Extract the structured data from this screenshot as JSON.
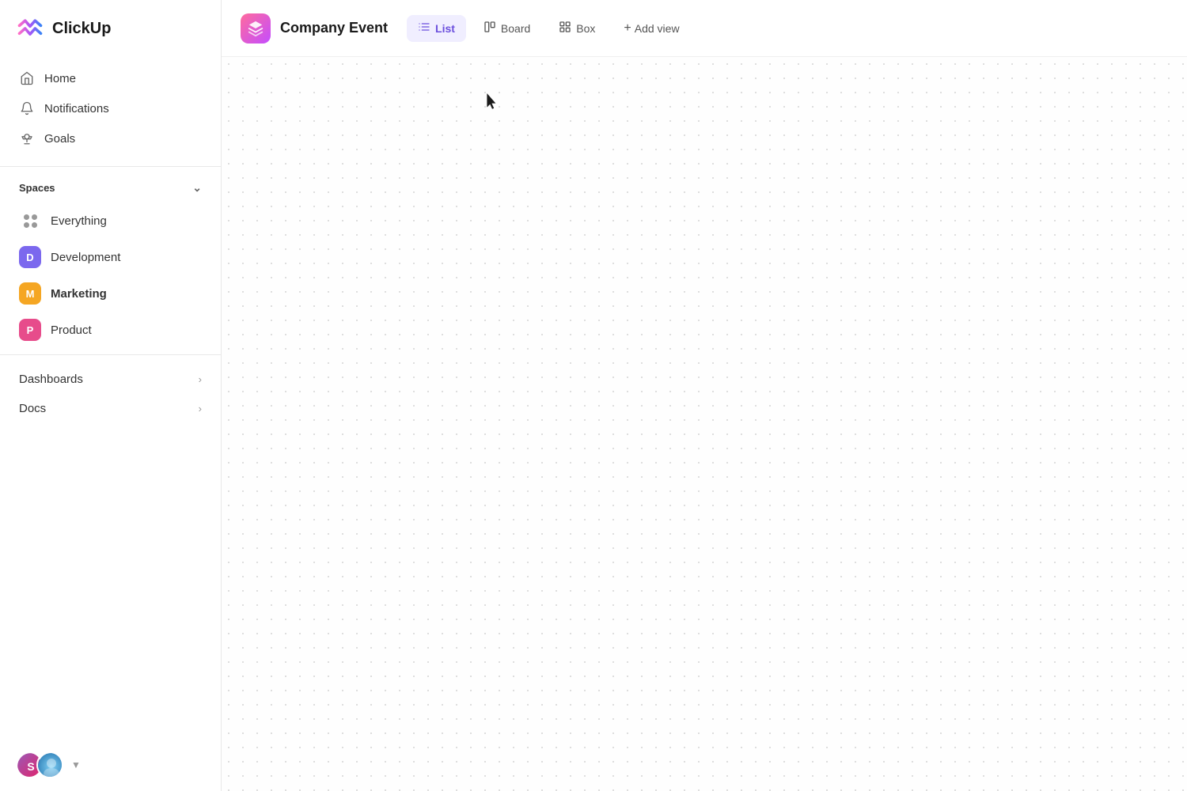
{
  "app": {
    "logo_text": "ClickUp"
  },
  "sidebar": {
    "nav": [
      {
        "id": "home",
        "label": "Home",
        "icon": "home"
      },
      {
        "id": "notifications",
        "label": "Notifications",
        "icon": "bell"
      },
      {
        "id": "goals",
        "label": "Goals",
        "icon": "trophy"
      }
    ],
    "spaces_label": "Spaces",
    "spaces": [
      {
        "id": "everything",
        "label": "Everything",
        "type": "dots"
      },
      {
        "id": "development",
        "label": "Development",
        "badge": "D",
        "color": "#7b68ee"
      },
      {
        "id": "marketing",
        "label": "Marketing",
        "badge": "M",
        "color": "#f5a623",
        "bold": true
      },
      {
        "id": "product",
        "label": "Product",
        "badge": "P",
        "color": "#e74c8b"
      }
    ],
    "sections": [
      {
        "id": "dashboards",
        "label": "Dashboards"
      },
      {
        "id": "docs",
        "label": "Docs"
      }
    ]
  },
  "topbar": {
    "project_name": "Company Event",
    "views": [
      {
        "id": "list",
        "label": "List",
        "icon": "≡",
        "active": true
      },
      {
        "id": "board",
        "label": "Board",
        "icon": "⊞",
        "active": false
      },
      {
        "id": "box",
        "label": "Box",
        "icon": "⊟",
        "active": false
      }
    ],
    "add_view_label": "Add view"
  }
}
